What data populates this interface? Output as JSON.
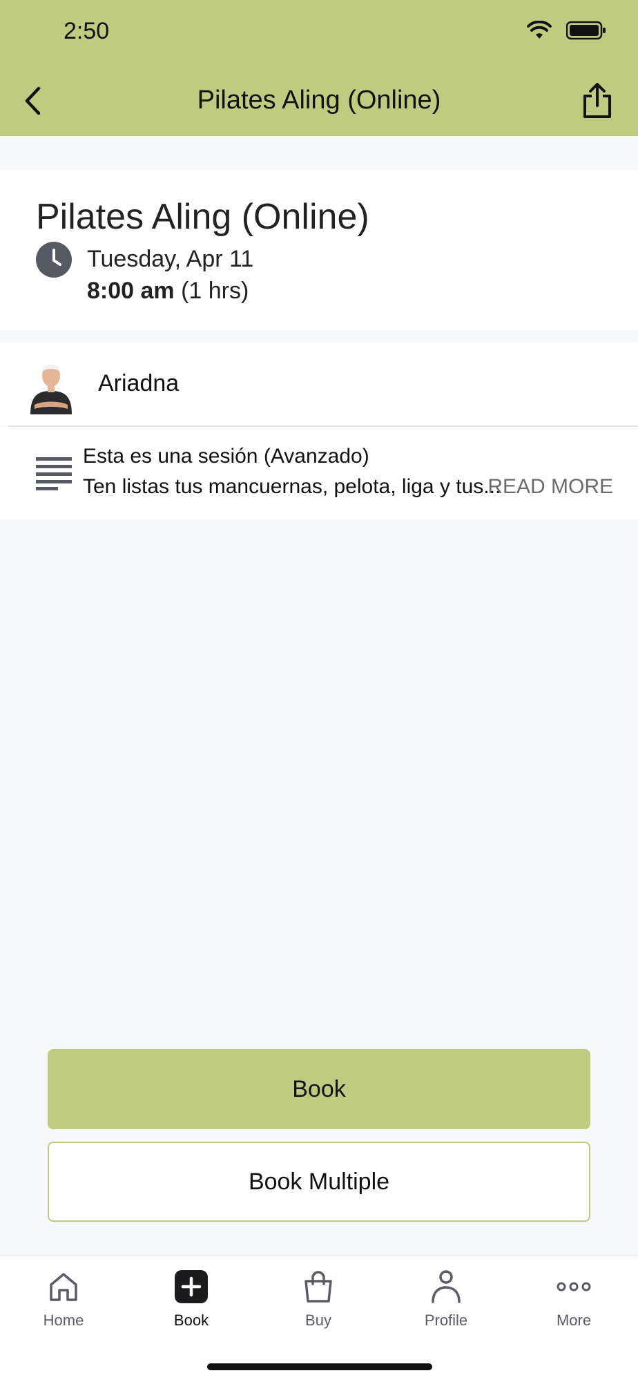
{
  "status_bar": {
    "time": "2:50"
  },
  "nav": {
    "title": "Pilates Aling (Online)"
  },
  "class": {
    "title": "Pilates Aling (Online)",
    "date": "Tuesday, Apr 11",
    "start_time": "8:00 am",
    "duration": "(1 hrs)"
  },
  "instructor": {
    "name": "Ariadna"
  },
  "description": {
    "line1": "Esta es una sesión (Avanzado)",
    "line2": "Ten listas tus mancuernas, pelota, liga y tus...",
    "read_more": "READ MORE"
  },
  "actions": {
    "book": "Book",
    "book_multiple": "Book Multiple"
  },
  "tabs": [
    {
      "label": "Home",
      "icon": "home-icon"
    },
    {
      "label": "Book",
      "icon": "plus-square-icon"
    },
    {
      "label": "Buy",
      "icon": "shopping-bag-icon"
    },
    {
      "label": "Profile",
      "icon": "person-icon"
    },
    {
      "label": "More",
      "icon": "more-dots-icon"
    }
  ],
  "colors": {
    "accent": "#bfcc80",
    "background": "#f7f8fa"
  }
}
